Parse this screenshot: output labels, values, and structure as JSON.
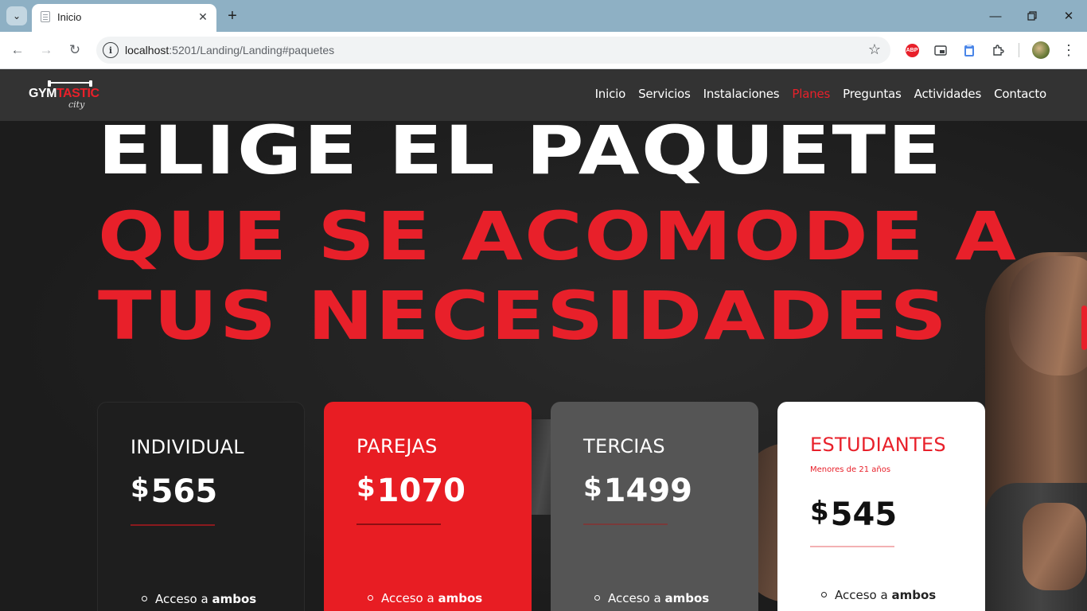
{
  "browser": {
    "tab_title": "Inicio",
    "url_host": "localhost",
    "url_path": ":5201/Landing/Landing#paquetes",
    "abp_label": "ABP"
  },
  "site": {
    "logo": {
      "main": "GYM",
      "accent": "TASTIC",
      "script": "city"
    },
    "menu": [
      {
        "label": "Inicio",
        "active": false
      },
      {
        "label": "Servicios",
        "active": false
      },
      {
        "label": "Instalaciones",
        "active": false
      },
      {
        "label": "Planes",
        "active": true
      },
      {
        "label": "Preguntas",
        "active": false
      },
      {
        "label": "Actividades",
        "active": false
      },
      {
        "label": "Contacto",
        "active": false
      }
    ],
    "accent_color": "#e8202a"
  },
  "headline": {
    "line1": "ELIGE EL PAQUETE",
    "line2": "QUE SE ACOMODE A",
    "line3": "TUS NECESIDADES"
  },
  "plans": [
    {
      "name": "INDIVIDUAL",
      "currency": "$",
      "price": "565",
      "feature_prefix": "Acceso a ",
      "feature_bold": "ambos"
    },
    {
      "name": "PAREJAS",
      "currency": "$",
      "price": "1070",
      "feature_prefix": "Acceso a ",
      "feature_bold": "ambos"
    },
    {
      "name": "TERCIAS",
      "currency": "$",
      "price": "1499",
      "feature_prefix": "Acceso a ",
      "feature_bold": "ambos"
    },
    {
      "name": "ESTUDIANTES",
      "subtitle": "Menores de 21 años",
      "currency": "$",
      "price": "545",
      "feature_prefix": "Acceso a ",
      "feature_bold": "ambos"
    }
  ]
}
